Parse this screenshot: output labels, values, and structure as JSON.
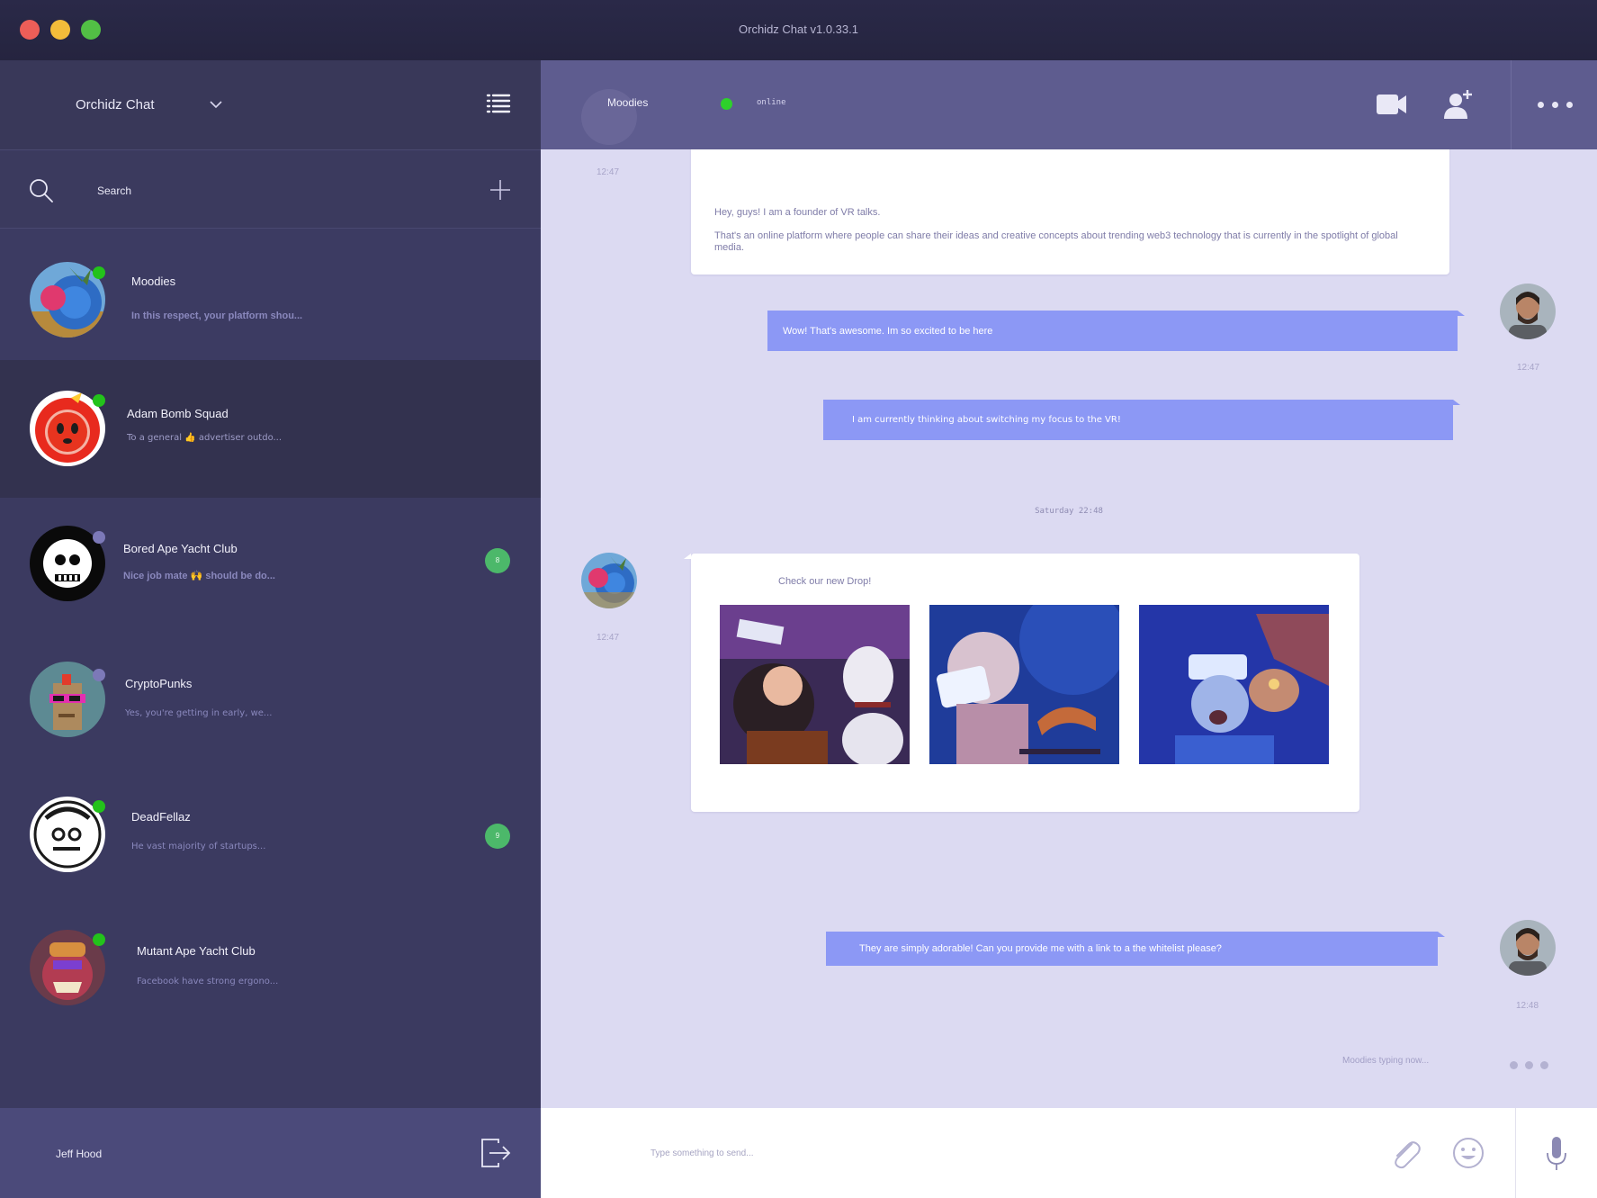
{
  "window": {
    "title": "Orchidz Chat v1.0.33.1"
  },
  "sidebar": {
    "title": "Orchidz Chat",
    "search_label": "Search",
    "contacts": [
      {
        "name": "Moodies",
        "preview": "In this respect, your platform shou...",
        "status": "online",
        "badge": ""
      },
      {
        "name": "Adam Bomb Squad",
        "preview": "To a general 👍 advertiser outdo...",
        "status": "online",
        "badge": ""
      },
      {
        "name": "Bored Ape Yacht Club",
        "preview": "Nice job mate 🙌 should be do...",
        "status": "offline",
        "badge": "8"
      },
      {
        "name": "CryptoPunks",
        "preview": "Yes, you're getting in early, we...",
        "status": "offline",
        "badge": ""
      },
      {
        "name": "DeadFellaz",
        "preview": "He vast majority of startups...",
        "status": "online",
        "badge": "9"
      },
      {
        "name": "Mutant Ape Yacht Club",
        "preview": "Facebook have strong ergono...",
        "status": "online",
        "badge": ""
      }
    ],
    "user_name": "Jeff Hood"
  },
  "chat": {
    "contact_name": "Moodies",
    "contact_status": "online",
    "messages": [
      {
        "text": "Hey, guys! I am a founder of VR talks.",
        "text2": "That's an online platform where people can share their ideas and creative concepts about trending web3 technology that is currently in the spotlight of global media.",
        "time": "12:47"
      },
      {
        "text": "Wow! That's awesome. I​m so excited to be here",
        "time": "12:47"
      },
      {
        "text": "I am currently thinking about switching my focus to the VR!"
      },
      {
        "text": "Check our new Drop!",
        "time": "12:47"
      },
      {
        "text": "They are simply adorable! Can you provide me with a link to a the whitelist please?",
        "time": "12:48"
      }
    ],
    "day_separator": "Saturday 22:48",
    "typing_text": "Moodies typing now...",
    "composer_placeholder": "Type something to send..."
  },
  "colors": {
    "sidebar_bg": "#3b3a60",
    "chat_bg": "#dcdaf2",
    "outgoing_bubble": "#8c98f5",
    "online": "#23c21b",
    "badge": "#4cb86a"
  }
}
